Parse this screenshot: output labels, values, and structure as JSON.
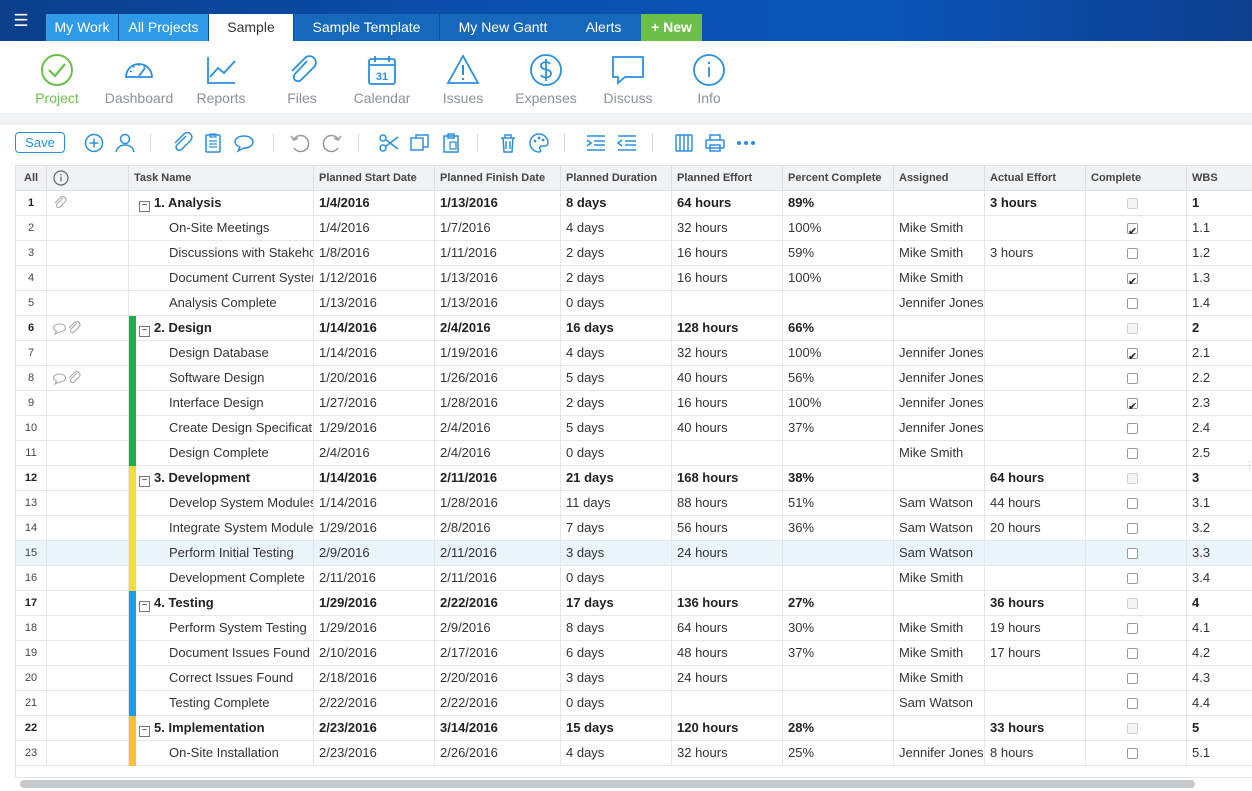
{
  "topbar": {
    "menu_icon": "hamburger-icon",
    "tabs": [
      {
        "label": "My Work",
        "color": "#2f9be8"
      },
      {
        "label": "All Projects",
        "color": "#2f9be8"
      },
      {
        "label": "Sample",
        "color": "#ffffff"
      },
      {
        "label": "Sample Template",
        "color": "#1668bb"
      },
      {
        "label": "My New Gantt",
        "color": "#1668bb"
      },
      {
        "label": "Alerts",
        "color": "#1668bb"
      },
      {
        "label": "+ New",
        "color": "#6cc04a"
      }
    ]
  },
  "nav": [
    {
      "label": "Project",
      "icon": "check-circle-icon",
      "active": true
    },
    {
      "label": "Dashboard",
      "icon": "gauge-icon"
    },
    {
      "label": "Reports",
      "icon": "line-chart-icon"
    },
    {
      "label": "Files",
      "icon": "paperclip-icon"
    },
    {
      "label": "Calendar",
      "icon": "calendar-icon",
      "day": "31"
    },
    {
      "label": "Issues",
      "icon": "warning-icon"
    },
    {
      "label": "Expenses",
      "icon": "dollar-circle-icon"
    },
    {
      "label": "Discuss",
      "icon": "chat-bubble-icon"
    },
    {
      "label": "Info",
      "icon": "info-circle-icon"
    }
  ],
  "toolbar": {
    "save_label": "Save",
    "icons": [
      "add-task-icon",
      "assign-user-icon",
      "attach-icon",
      "notes-icon",
      "comment-icon",
      "undo-icon",
      "redo-icon",
      "cut-icon",
      "copy-icon",
      "paste-icon",
      "delete-icon",
      "color-palette-icon",
      "indent-icon",
      "outdent-icon",
      "columns-icon",
      "print-icon",
      "more-icon"
    ]
  },
  "grid": {
    "all_label": "All",
    "info_icon": "info-icon",
    "columns": [
      "Task Name",
      "Planned Start Date",
      "Planned Finish Date",
      "Planned Duration",
      "Planned Effort",
      "Percent Complete",
      "Assigned",
      "Actual Effort",
      "Complete",
      "WBS"
    ],
    "rows": [
      {
        "n": "1",
        "name": "1. Analysis",
        "start": "1/4/2016",
        "finish": "1/13/2016",
        "dur": "8 days",
        "effort": "64 hours",
        "pct": "89%",
        "assigned": "",
        "actual": "3 hours",
        "complete": false,
        "wbs": "1",
        "summary": true,
        "bar": "",
        "icons": "attach"
      },
      {
        "n": "2",
        "name": "On-Site Meetings",
        "start": "1/4/2016",
        "finish": "1/7/2016",
        "dur": "4 days",
        "effort": "32 hours",
        "pct": "100%",
        "assigned": "Mike Smith",
        "actual": "",
        "complete": true,
        "wbs": "1.1",
        "bar": ""
      },
      {
        "n": "3",
        "name": "Discussions with Stakeholders",
        "start": "1/8/2016",
        "finish": "1/11/2016",
        "dur": "2 days",
        "effort": "16 hours",
        "pct": "59%",
        "assigned": "Mike Smith",
        "actual": "3 hours",
        "complete": false,
        "wbs": "1.2",
        "bar": ""
      },
      {
        "n": "4",
        "name": "Document Current Systems",
        "start": "1/12/2016",
        "finish": "1/13/2016",
        "dur": "2 days",
        "effort": "16 hours",
        "pct": "100%",
        "assigned": "Mike Smith",
        "actual": "",
        "complete": true,
        "wbs": "1.3",
        "bar": ""
      },
      {
        "n": "5",
        "name": "Analysis Complete",
        "start": "1/13/2016",
        "finish": "1/13/2016",
        "dur": "0 days",
        "effort": "",
        "pct": "",
        "assigned": "Jennifer Jones",
        "actual": "",
        "complete": false,
        "wbs": "1.4",
        "bar": ""
      },
      {
        "n": "6",
        "name": "2. Design",
        "start": "1/14/2016",
        "finish": "2/4/2016",
        "dur": "16 days",
        "effort": "128 hours",
        "pct": "66%",
        "assigned": "",
        "actual": "",
        "complete": false,
        "wbs": "2",
        "summary": true,
        "bar": "#1fad4b",
        "icons": "comment-attach"
      },
      {
        "n": "7",
        "name": "Design Database",
        "start": "1/14/2016",
        "finish": "1/19/2016",
        "dur": "4 days",
        "effort": "32 hours",
        "pct": "100%",
        "assigned": "Jennifer Jones",
        "actual": "",
        "complete": true,
        "wbs": "2.1",
        "bar": "#1fad4b"
      },
      {
        "n": "8",
        "name": "Software Design",
        "start": "1/20/2016",
        "finish": "1/26/2016",
        "dur": "5 days",
        "effort": "40 hours",
        "pct": "56%",
        "assigned": "Jennifer Jones",
        "actual": "",
        "complete": false,
        "wbs": "2.2",
        "bar": "#1fad4b",
        "icons": "comment-attach"
      },
      {
        "n": "9",
        "name": "Interface Design",
        "start": "1/27/2016",
        "finish": "1/28/2016",
        "dur": "2 days",
        "effort": "16 hours",
        "pct": "100%",
        "assigned": "Jennifer Jones",
        "actual": "",
        "complete": true,
        "wbs": "2.3",
        "bar": "#1fad4b"
      },
      {
        "n": "10",
        "name": "Create Design Specification",
        "start": "1/29/2016",
        "finish": "2/4/2016",
        "dur": "5 days",
        "effort": "40 hours",
        "pct": "37%",
        "assigned": "Jennifer Jones",
        "actual": "",
        "complete": false,
        "wbs": "2.4",
        "bar": "#1fad4b"
      },
      {
        "n": "11",
        "name": "Design Complete",
        "start": "2/4/2016",
        "finish": "2/4/2016",
        "dur": "0 days",
        "effort": "",
        "pct": "",
        "assigned": "Mike Smith",
        "actual": "",
        "complete": false,
        "wbs": "2.5",
        "bar": "#1fad4b"
      },
      {
        "n": "12",
        "name": "3. Development",
        "start": "1/14/2016",
        "finish": "2/11/2016",
        "dur": "21 days",
        "effort": "168 hours",
        "pct": "38%",
        "assigned": "",
        "actual": "64 hours",
        "complete": false,
        "wbs": "3",
        "summary": true,
        "bar": "#f3dd3c"
      },
      {
        "n": "13",
        "name": "Develop System Modules",
        "start": "1/14/2016",
        "finish": "1/28/2016",
        "dur": "11 days",
        "effort": "88 hours",
        "pct": "51%",
        "assigned": "Sam Watson",
        "actual": "44 hours",
        "complete": false,
        "wbs": "3.1",
        "bar": "#f3dd3c"
      },
      {
        "n": "14",
        "name": "Integrate System Modules",
        "start": "1/29/2016",
        "finish": "2/8/2016",
        "dur": "7 days",
        "effort": "56 hours",
        "pct": "36%",
        "assigned": "Sam Watson",
        "actual": "20 hours",
        "complete": false,
        "wbs": "3.2",
        "bar": "#f3dd3c"
      },
      {
        "n": "15",
        "name": "Perform Initial Testing",
        "start": "2/9/2016",
        "finish": "2/11/2016",
        "dur": "3 days",
        "effort": "24 hours",
        "pct": "",
        "assigned": "Sam Watson",
        "actual": "",
        "complete": false,
        "wbs": "3.3",
        "bar": "#f3dd3c",
        "selected": true
      },
      {
        "n": "16",
        "name": "Development Complete",
        "start": "2/11/2016",
        "finish": "2/11/2016",
        "dur": "0 days",
        "effort": "",
        "pct": "",
        "assigned": "Mike Smith",
        "actual": "",
        "complete": false,
        "wbs": "3.4",
        "bar": "#f3dd3c"
      },
      {
        "n": "17",
        "name": "4. Testing",
        "start": "1/29/2016",
        "finish": "2/22/2016",
        "dur": "17 days",
        "effort": "136 hours",
        "pct": "27%",
        "assigned": "",
        "actual": "36 hours",
        "complete": false,
        "wbs": "4",
        "summary": true,
        "bar": "#1e9be6"
      },
      {
        "n": "18",
        "name": "Perform System Testing",
        "start": "1/29/2016",
        "finish": "2/9/2016",
        "dur": "8 days",
        "effort": "64 hours",
        "pct": "30%",
        "assigned": "Mike Smith",
        "actual": "19 hours",
        "complete": false,
        "wbs": "4.1",
        "bar": "#1e9be6"
      },
      {
        "n": "19",
        "name": "Document Issues Found",
        "start": "2/10/2016",
        "finish": "2/17/2016",
        "dur": "6 days",
        "effort": "48 hours",
        "pct": "37%",
        "assigned": "Mike Smith",
        "actual": "17 hours",
        "complete": false,
        "wbs": "4.2",
        "bar": "#1e9be6"
      },
      {
        "n": "20",
        "name": "Correct Issues Found",
        "start": "2/18/2016",
        "finish": "2/20/2016",
        "dur": "3 days",
        "effort": "24 hours",
        "pct": "",
        "assigned": "Mike Smith",
        "actual": "",
        "complete": false,
        "wbs": "4.3",
        "bar": "#1e9be6"
      },
      {
        "n": "21",
        "name": "Testing Complete",
        "start": "2/22/2016",
        "finish": "2/22/2016",
        "dur": "0 days",
        "effort": "",
        "pct": "",
        "assigned": "Sam Watson",
        "actual": "",
        "complete": false,
        "wbs": "4.4",
        "bar": "#1e9be6"
      },
      {
        "n": "22",
        "name": "5. Implementation",
        "start": "2/23/2016",
        "finish": "3/14/2016",
        "dur": "15 days",
        "effort": "120 hours",
        "pct": "28%",
        "assigned": "",
        "actual": "33 hours",
        "complete": false,
        "wbs": "5",
        "summary": true,
        "bar": "#f7bf3a"
      },
      {
        "n": "23",
        "name": "On-Site Installation",
        "start": "2/23/2016",
        "finish": "2/26/2016",
        "dur": "4 days",
        "effort": "32 hours",
        "pct": "25%",
        "assigned": "Jennifer Jones",
        "actual": "8 hours",
        "complete": false,
        "wbs": "5.1",
        "bar": "#f7bf3a"
      }
    ]
  }
}
